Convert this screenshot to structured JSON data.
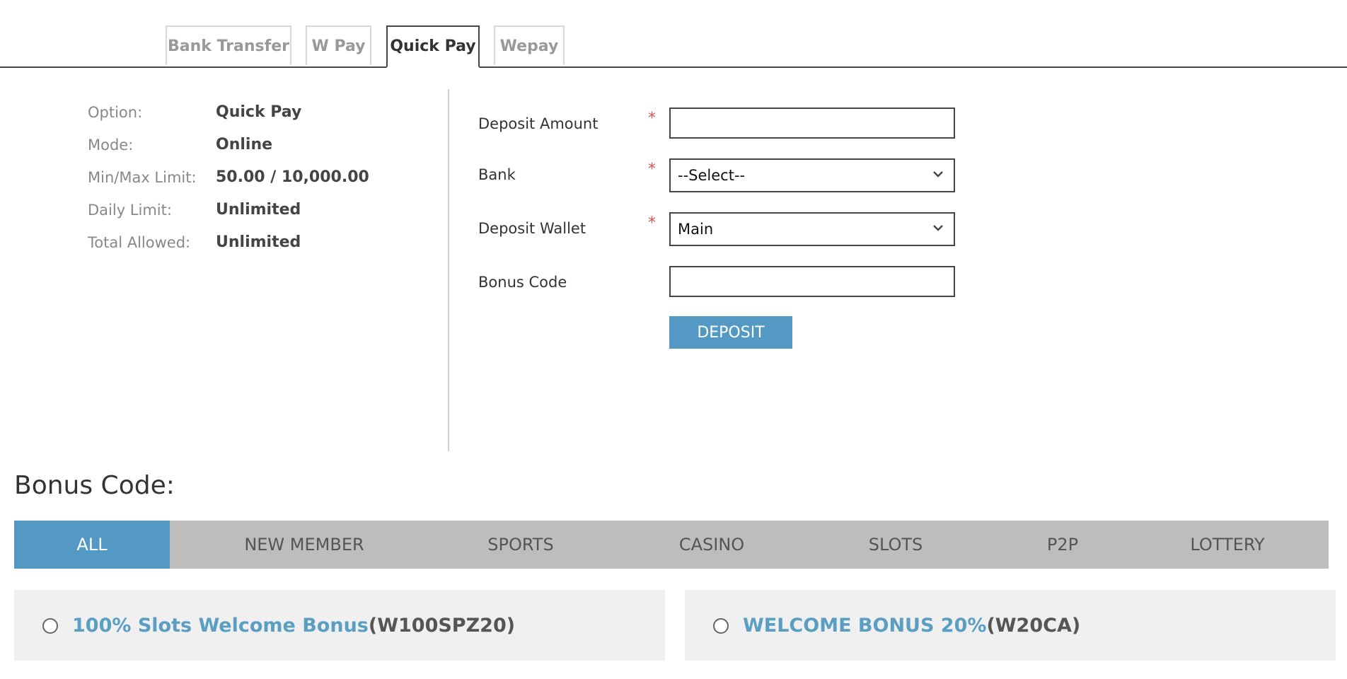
{
  "tabs": [
    {
      "label": "Bank Transfer",
      "active": false
    },
    {
      "label": "W Pay",
      "active": false
    },
    {
      "label": "Quick Pay",
      "active": true
    },
    {
      "label": "Wepay",
      "active": false
    }
  ],
  "info": {
    "option_label": "Option:",
    "option_value": "Quick Pay",
    "mode_label": "Mode:",
    "mode_value": "Online",
    "limit_label": "Min/Max Limit:",
    "limit_value": "50.00 / 10,000.00",
    "daily_label": "Daily Limit:",
    "daily_value": "Unlimited",
    "total_label": "Total Allowed:",
    "total_value": "Unlimited"
  },
  "form": {
    "required_mark": "*",
    "deposit_amount_label": "Deposit Amount",
    "deposit_amount_value": "",
    "bank_label": "Bank",
    "bank_selected": "--Select--",
    "wallet_label": "Deposit Wallet",
    "wallet_selected": "Main",
    "bonus_code_label": "Bonus Code",
    "bonus_code_value": "",
    "deposit_button": "DEPOSIT"
  },
  "bonus": {
    "title": "Bonus Code:",
    "categories": [
      "ALL",
      "NEW MEMBER",
      "SPORTS",
      "CASINO",
      "SLOTS",
      "P2P",
      "LOTTERY"
    ],
    "active_category": "ALL",
    "cards": [
      {
        "name": "100% Slots Welcome Bonus",
        "code": "(W100SPZ20)"
      },
      {
        "name": "WELCOME BONUS 20%",
        "code": "(W20CA)"
      }
    ]
  },
  "colors": {
    "accent": "#5499c3",
    "required": "#d9534f",
    "bonus_link": "#5a9ec2"
  }
}
